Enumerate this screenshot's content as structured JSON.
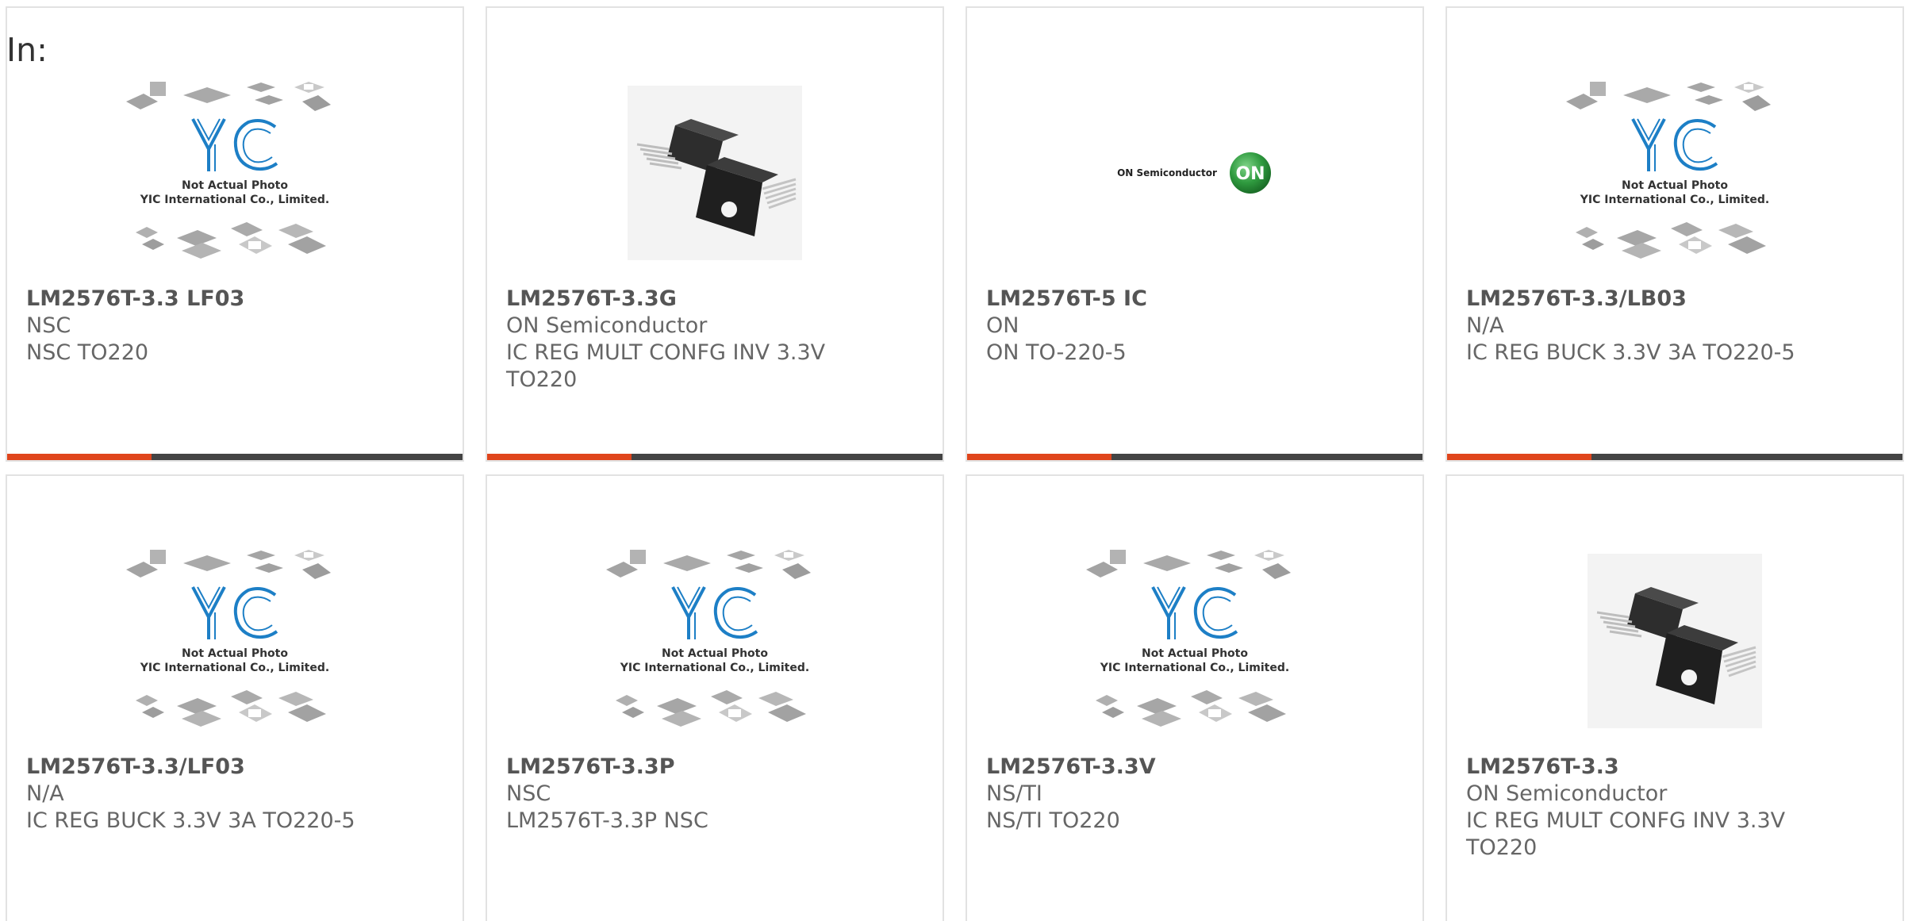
{
  "filter_label": "In:",
  "placeholder": {
    "line1": "Not Actual Photo",
    "line2": "YIC International Co., Limited.",
    "logo": "YIC"
  },
  "onsemi": {
    "text": "ON Semiconductor",
    "badge": "ON"
  },
  "colors": {
    "accent": "#e0451c",
    "bar": "#444444",
    "yic_blue": "#1d7fc6"
  },
  "products": [
    {
      "part_no": "LM2576T-3.3 LF03",
      "manufacturer": "NSC",
      "description": "NSC TO220",
      "image": "placeholder"
    },
    {
      "part_no": "LM2576T-3.3G",
      "manufacturer": "ON Semiconductor",
      "description": "IC REG MULT CONFG INV 3.3V TO220",
      "image": "to220-photo"
    },
    {
      "part_no": "LM2576T-5 IC",
      "manufacturer": "ON",
      "description": "ON TO-220-5",
      "image": "onsemi-logo"
    },
    {
      "part_no": "LM2576T-3.3/LB03",
      "manufacturer": "N/A",
      "description": "IC REG BUCK 3.3V 3A TO220-5",
      "image": "placeholder"
    },
    {
      "part_no": "LM2576T-3.3/LF03",
      "manufacturer": "N/A",
      "description": "IC REG BUCK 3.3V 3A TO220-5",
      "image": "placeholder"
    },
    {
      "part_no": "LM2576T-3.3P",
      "manufacturer": "NSC",
      "description": "LM2576T-3.3P NSC",
      "image": "placeholder"
    },
    {
      "part_no": "LM2576T-3.3V",
      "manufacturer": "NS/TI",
      "description": "NS/TI TO220",
      "image": "placeholder"
    },
    {
      "part_no": "LM2576T-3.3",
      "manufacturer": "ON Semiconductor",
      "description": "IC REG MULT CONFG INV 3.3V TO220",
      "image": "to220-photo"
    }
  ]
}
